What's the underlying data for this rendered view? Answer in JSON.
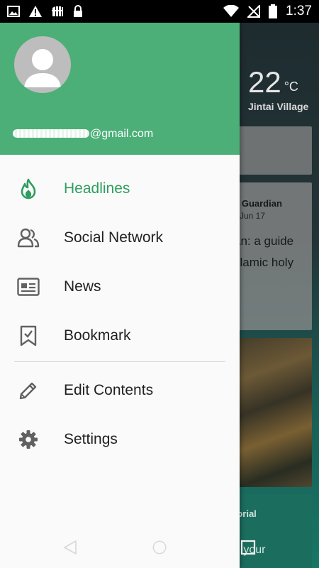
{
  "status_bar": {
    "time": "1:37",
    "icons_left": [
      "image-icon",
      "warning-icon",
      "sim-icon",
      "lock-icon"
    ],
    "icons_right": [
      "wifi-icon",
      "no-signal-icon",
      "battery-icon"
    ]
  },
  "background_app": {
    "temperature": "22",
    "temperature_unit": "°C",
    "location": "Jintai Village",
    "card_source": "e Guardian",
    "card_date": "Jun 17",
    "card_headline_line1": "an: a guide",
    "card_headline_line2": "slamic holy",
    "card4_label": "torial",
    "card4_teaser": "g your"
  },
  "drawer": {
    "header_color": "#4caf78",
    "email_visible": "@gmail.com",
    "accent_color": "#2e9e5e",
    "items": [
      {
        "label": "Headlines",
        "icon": "flame-icon",
        "active": true
      },
      {
        "label": "Social Network",
        "icon": "people-icon",
        "active": false
      },
      {
        "label": "News",
        "icon": "newspaper-icon",
        "active": false
      },
      {
        "label": "Bookmark",
        "icon": "bookmark-check-icon",
        "active": false
      },
      {
        "label": "Edit Contents",
        "icon": "pencil-icon",
        "active": false
      },
      {
        "label": "Settings",
        "icon": "gear-icon",
        "active": false
      }
    ]
  },
  "nav_bar": {
    "buttons": [
      "back-icon",
      "home-icon",
      "recents-icon"
    ]
  }
}
